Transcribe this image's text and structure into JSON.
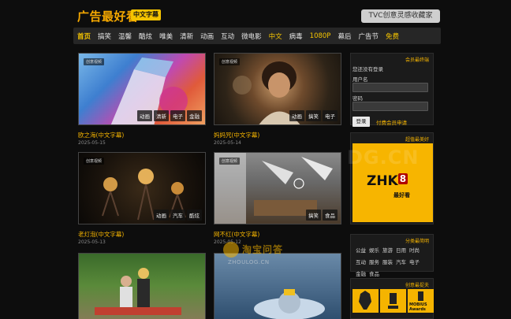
{
  "header": {
    "title": "广告最好看",
    "badge": "中文字幕",
    "fav_link": "TVC创意灵感收藏家"
  },
  "nav": {
    "items": [
      "首页",
      "搞笑",
      "温馨",
      "酷炫",
      "唯美",
      "清新",
      "动画",
      "互动",
      "微电影",
      "中文",
      "病毒",
      "1080P",
      "幕后",
      "广告节",
      "免费"
    ]
  },
  "cards": [
    {
      "tag": "创意视频",
      "title": "欧之海(中文字幕)",
      "date": "2025-05-15",
      "tags": [
        "动画",
        "清新",
        "电子",
        "金融"
      ]
    },
    {
      "tag": "创意视频",
      "title": "妈妈咒(中文字幕)",
      "date": "2025-05-14",
      "tags": [
        "动画",
        "搞笑",
        "电子"
      ]
    },
    {
      "tag": "创意视频",
      "title": "老灯泡(中文字幕)",
      "date": "2025-05-13",
      "tags": [
        "动画",
        "汽车",
        "酷炫"
      ]
    },
    {
      "tag": "创意视频",
      "title": "网不红(中文字幕)",
      "date": "2025-05-12",
      "tags": [
        "搞笑",
        "食品"
      ]
    },
    {
      "tag": "",
      "title": "",
      "date": "",
      "tags": [
        "",
        "",
        ""
      ]
    },
    {
      "tag": "",
      "title": "",
      "date": "",
      "tags": []
    }
  ],
  "sidebar": {
    "login": {
      "heading": "会员最终端",
      "not_logged": "您还没有登录",
      "username_label": "用户名",
      "password_label": "密码",
      "login_button": "登录",
      "apply_link": "付费会员申请"
    },
    "ad": {
      "heading": "超值最美好",
      "logo": "ZHK",
      "logo_num": "8",
      "sub": "最好看"
    },
    "categories": {
      "heading": "分类最简明",
      "items": [
        "公益",
        "娱乐",
        "旅游",
        "日用",
        "时尚",
        "互动",
        "服务",
        "服装",
        "汽车",
        "电子",
        "金融",
        "食品"
      ]
    },
    "awards": {
      "heading": "创意最捉夫",
      "label": "MOBIUS Awards"
    }
  },
  "watermark": {
    "cn": "淘宝问答",
    "en": "ZHOULOG.CN",
    "bg": "DG.CN"
  },
  "colors": {
    "accent": "#f5b400",
    "background": "#0d0d0d"
  }
}
